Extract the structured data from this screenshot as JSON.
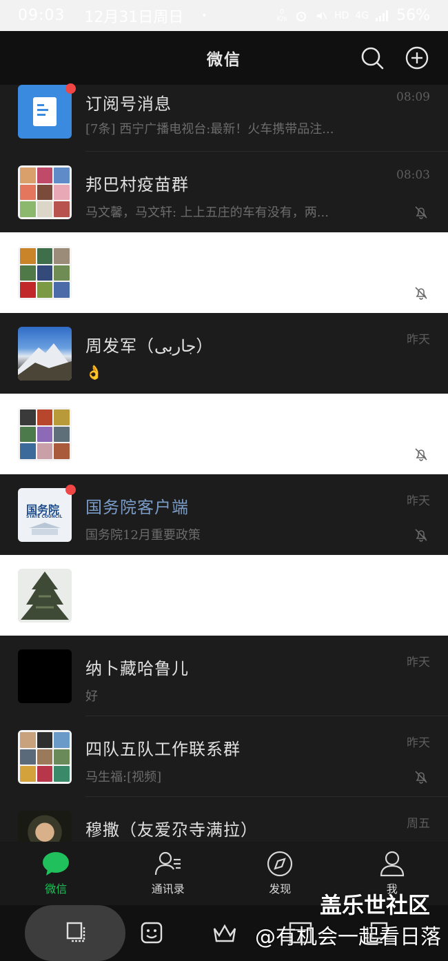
{
  "status_bar": {
    "time": "09:03",
    "date": "12月31日周日",
    "dot": "•",
    "net_speed": "0 K/s",
    "hd": "HD",
    "network": "4G",
    "battery": "56%"
  },
  "header": {
    "title": "微信",
    "search_icon": "search-icon",
    "add_icon": "plus-circle-icon"
  },
  "chats": [
    {
      "name": "订阅号消息",
      "preview": "[7条] 西宁广播电视台:最新！火车携带品注...",
      "time": "08:09",
      "muted": false,
      "unread_dot": true
    },
    {
      "name": "邦巴村疫苗群",
      "preview": "马文馨，马文轩: 上上五庄的车有没有，两...",
      "time": "08:03",
      "muted": true,
      "unread_dot": false
    },
    {
      "name": "",
      "preview": "",
      "time": "",
      "muted": true,
      "unread_dot": false
    },
    {
      "name": "周发军（جاربى）",
      "preview": "👌",
      "time": "昨天",
      "muted": false,
      "unread_dot": false
    },
    {
      "name": "",
      "preview": "",
      "time": "",
      "muted": true,
      "unread_dot": false
    },
    {
      "name": "国务院客户端",
      "preview": "国务院12月重要政策",
      "time": "昨天",
      "muted": true,
      "unread_dot": true,
      "avatar_text": "国务院",
      "avatar_sub": "STATE COUNCIL"
    },
    {
      "name": "",
      "preview": "",
      "time": "",
      "muted": false,
      "unread_dot": false
    },
    {
      "name": "纳卜藏哈鲁儿",
      "preview": "好",
      "time": "昨天",
      "muted": false,
      "unread_dot": false
    },
    {
      "name": "四队五队工作联系群",
      "preview": "马生福:[视频]",
      "time": "昨天",
      "muted": true,
      "unread_dot": false
    },
    {
      "name": "穆撒（友爱尕寺满拉）",
      "preview": "",
      "time": "周五",
      "muted": false,
      "unread_dot": false
    }
  ],
  "tabs": [
    {
      "label": "微信",
      "icon": "chat-bubble-icon",
      "active": true
    },
    {
      "label": "通讯录",
      "icon": "contacts-icon",
      "active": false
    },
    {
      "label": "发现",
      "icon": "compass-icon",
      "active": false
    },
    {
      "label": "我",
      "icon": "person-icon",
      "active": false
    }
  ],
  "system_bar": {
    "icons": [
      "screenshot-icon",
      "sticker-icon",
      "crown-icon",
      "grid-icon",
      "copy-icon"
    ]
  },
  "watermark": {
    "line1": "盖乐世社区",
    "line2": "@有机会一起看日落"
  },
  "colors": {
    "accent": "#20c05c",
    "badge": "#f04646",
    "link_name": "#7a9cc9"
  }
}
